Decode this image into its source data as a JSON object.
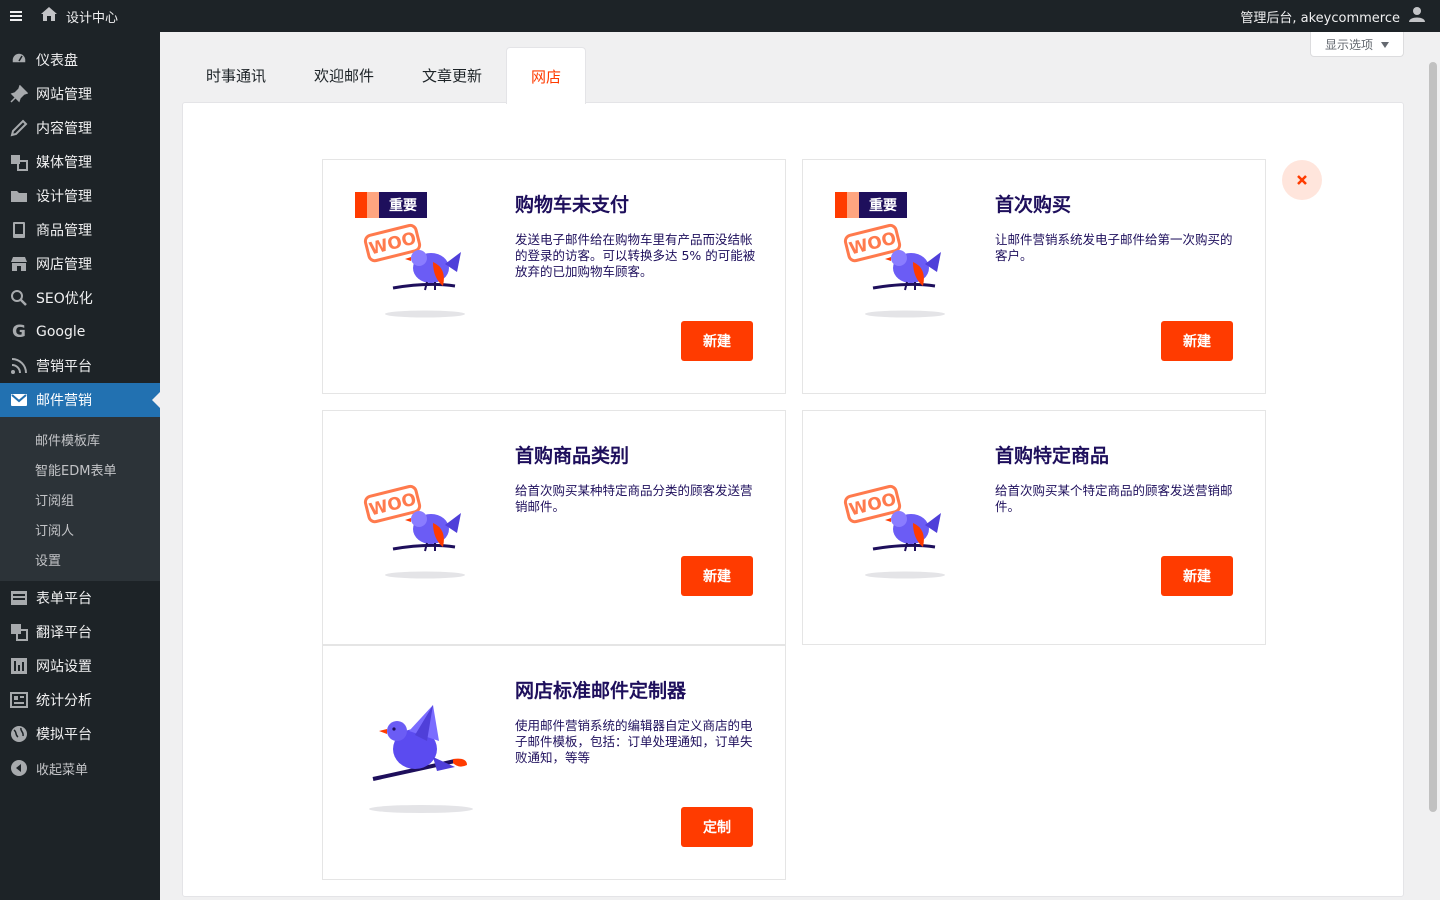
{
  "adminbar": {
    "site_title": "设计中心",
    "account_label": "管理后台, akeycommerce"
  },
  "sidebar": {
    "items": [
      {
        "label": "仪表盘",
        "icon": "dashboard-icon"
      },
      {
        "label": "网站管理",
        "icon": "pin-icon"
      },
      {
        "label": "内容管理",
        "icon": "pencil-icon"
      },
      {
        "label": "媒体管理",
        "icon": "media-icon"
      },
      {
        "label": "设计管理",
        "icon": "folder-icon"
      },
      {
        "label": "商品管理",
        "icon": "book-icon"
      },
      {
        "label": "网店管理",
        "icon": "store-icon"
      },
      {
        "label": "SEO优化",
        "icon": "search-icon"
      },
      {
        "label": "Google",
        "icon": "google-icon"
      },
      {
        "label": "营销平台",
        "icon": "rss-icon"
      },
      {
        "label": "邮件营销",
        "icon": "email-icon"
      }
    ],
    "submenu": [
      "邮件模板库",
      "智能EDM表单",
      "订阅组",
      "订阅人",
      "设置"
    ],
    "items_after": [
      {
        "label": "表单平台",
        "icon": "form-icon"
      },
      {
        "label": "翻译平台",
        "icon": "translate-icon"
      },
      {
        "label": "网站设置",
        "icon": "settings-icon"
      },
      {
        "label": "统计分析",
        "icon": "analytics-icon"
      },
      {
        "label": "模拟平台",
        "icon": "globe-icon"
      }
    ],
    "collapse_label": "收起菜单"
  },
  "screen_options": "显示选项",
  "tabs": [
    "时事通讯",
    "欢迎邮件",
    "文章更新",
    "网店"
  ],
  "badge_label": "重要",
  "cards": [
    {
      "title": "购物车未支付",
      "desc": "发送电子邮件给在购物车里有产品而没结帐的登录的访客。可以转换多达 5% 的可能被放弃的已加购物车顾客。",
      "button": "新建",
      "important": true
    },
    {
      "title": "首次购买",
      "desc": "让邮件营销系统发电子邮件给第一次购买的客户。",
      "button": "新建",
      "important": true
    },
    {
      "title": "首购商品类别",
      "desc": "给首次购买某种特定商品分类的顾客发送营销邮件。",
      "button": "新建",
      "important": false
    },
    {
      "title": "首购特定商品",
      "desc": "给首次购买某个特定商品的顾客发送营销邮件。",
      "button": "新建",
      "important": false
    },
    {
      "title": "网店标准邮件定制器",
      "desc": "使用邮件营销系统的编辑器自定义商店的电子邮件模板，包括：订单处理通知，订单失败通知，等等",
      "button": "定制",
      "important": false
    }
  ],
  "woo_label": "WOO",
  "colors": {
    "accent": "#ff3b00",
    "navy": "#1e0f5c",
    "admin_blue": "#2271b1",
    "sidebar_bg": "#1d2327"
  }
}
